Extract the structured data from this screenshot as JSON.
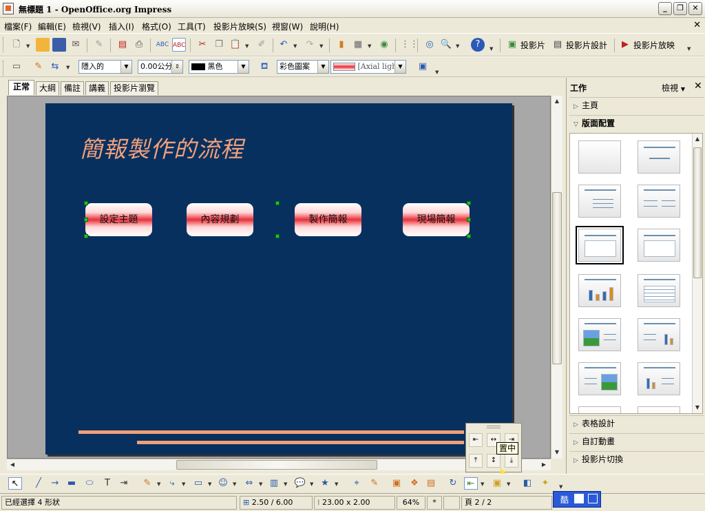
{
  "window": {
    "title": "無標題 1 - OpenOffice.org Impress",
    "buttons": [
      "_",
      "❐",
      "✕"
    ]
  },
  "menu": {
    "items": [
      "檔案(F)",
      "編輯(E)",
      "檢視(V)",
      "插入(I)",
      "格式(O)",
      "工具(T)",
      "投影片放映(S)",
      "視窗(W)",
      "說明(H)"
    ],
    "close_doc": "✕"
  },
  "toolbar": {
    "slide_btn": "投影片",
    "slide_design_btn": "投影片設計",
    "slideshow_btn": "投影片放映"
  },
  "line_toolbar": {
    "line_style": "隱入的",
    "line_width": "0.00公分",
    "line_color": "黑色",
    "area_style": "彩色圖案",
    "gradient": "[Axial light"
  },
  "tabs": [
    "正常",
    "大綱",
    "備註",
    "講義",
    "投影片瀏覽"
  ],
  "active_tab": "正常",
  "slide": {
    "title": "簡報製作的流程",
    "shapes": [
      "設定主題",
      "內容規劃",
      "製作簡報",
      "現場簡報"
    ],
    "colors": {
      "background": "#08305f",
      "title": "#f2a07a",
      "accent_line": "#f0a078",
      "pill_mid": "#e8303a"
    }
  },
  "taskpane": {
    "title": "工作",
    "view_btn": "檢視",
    "close": "✕",
    "sections_top": [
      "主頁",
      "版面配置"
    ],
    "sections_bottom": [
      "表格設計",
      "自訂動畫",
      "投影片切換"
    ],
    "open_section": "版面配置"
  },
  "flyout": {
    "tooltip": "置中"
  },
  "statusbar": {
    "selection": "已經選擇 4 形狀",
    "position": "2.50 / 6.00",
    "size": "23.00 x 2.00",
    "zoom": "64%",
    "modified": "*",
    "page": "頁 2 / 2"
  },
  "ime": {
    "label": "酷"
  }
}
